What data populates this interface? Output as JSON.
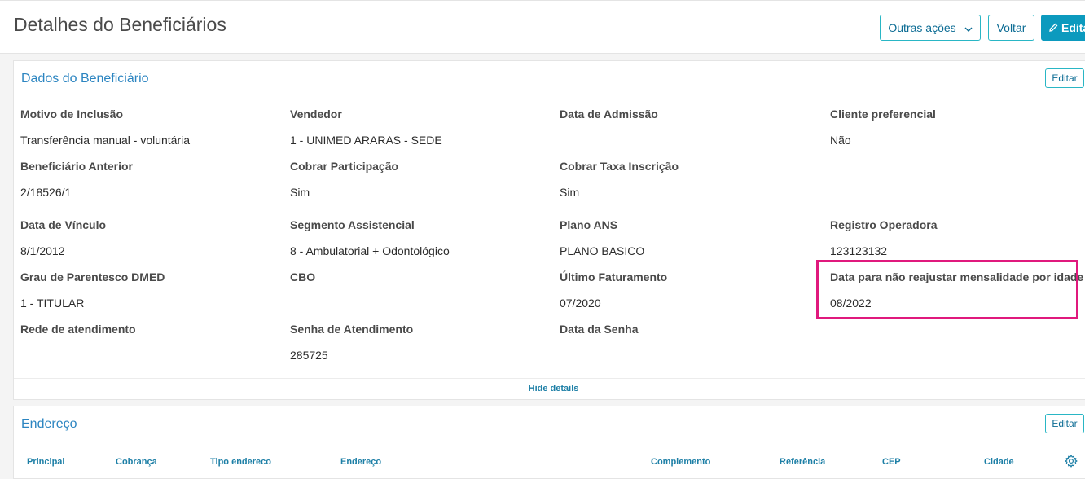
{
  "header": {
    "title": "Detalhes do Beneficiários",
    "outras_acoes_label": "Outras ações",
    "voltar_label": "Voltar",
    "editar_label": "Editar"
  },
  "dados": {
    "title": "Dados do Beneficiário",
    "edit_label": "Editar",
    "fields": [
      {
        "label": "Motivo de Inclusão",
        "value": "Transferência manual - voluntária"
      },
      {
        "label": "Vendedor",
        "value": "1 - UNIMED ARARAS - SEDE"
      },
      {
        "label": "Data de Admissão",
        "value": ""
      },
      {
        "label": "Cliente preferencial",
        "value": "Não"
      },
      {
        "label": "Beneficiário Anterior",
        "value": "2/18526/1"
      },
      {
        "label": "Cobrar Participação",
        "value": "Sim"
      },
      {
        "label": "Cobrar Taxa Inscrição",
        "value": "Sim"
      },
      {
        "label": "Data de Vínculo",
        "value": "8/1/2012"
      },
      {
        "label": "Segmento Assistencial",
        "value": "8 - Ambulatorial + Odontológico"
      },
      {
        "label": "Plano ANS",
        "value": "PLANO BASICO"
      },
      {
        "label": "Registro Operadora",
        "value": "123123132"
      },
      {
        "label": "Grau de Parentesco DMED",
        "value": "1 - TITULAR"
      },
      {
        "label": "CBO",
        "value": ""
      },
      {
        "label": "Último Faturamento",
        "value": "07/2020"
      },
      {
        "label": "Data para não reajustar mensalidade por idade",
        "value": "08/2022"
      },
      {
        "label": "Rede de atendimento",
        "value": ""
      },
      {
        "label": "Senha de Atendimento",
        "value": "285725"
      },
      {
        "label": "Data da Senha",
        "value": ""
      }
    ],
    "hide_details_label": "Hide details"
  },
  "endereco": {
    "title": "Endereço",
    "edit_label": "Editar",
    "columns": [
      "Principal",
      "Cobrança",
      "Tipo endereco",
      "Endereço",
      "Complemento",
      "Referência",
      "CEP",
      "Cidade"
    ]
  },
  "colors": {
    "accent": "#0c9abe",
    "highlight": "#e0197d"
  }
}
